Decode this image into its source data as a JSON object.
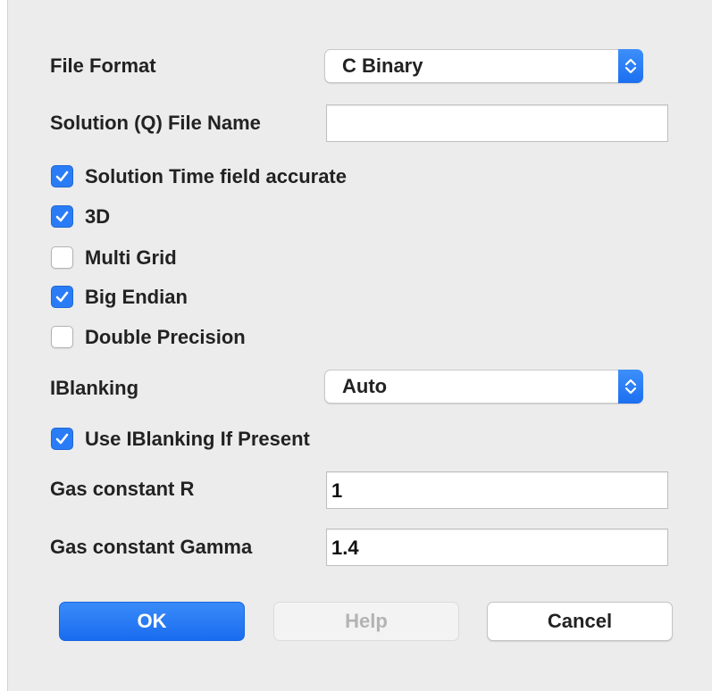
{
  "file_format": {
    "label": "File Format",
    "selected": "C Binary",
    "stepper_icon": "chevron-up-down-icon"
  },
  "solution_file": {
    "label": "Solution (Q) File Name",
    "value": ""
  },
  "checkboxes": [
    {
      "label": "Solution Time field accurate",
      "checked": true
    },
    {
      "label": "3D",
      "checked": true
    },
    {
      "label": "Multi Grid",
      "checked": false
    },
    {
      "label": "Big Endian",
      "checked": true
    },
    {
      "label": "Double Precision",
      "checked": false
    }
  ],
  "iblanking": {
    "label": "IBlanking",
    "selected": "Auto"
  },
  "use_iblanking": {
    "label": "Use IBlanking If Present",
    "checked": true
  },
  "gas_constant_r": {
    "label": "Gas constant R",
    "value": "1"
  },
  "gas_constant_gamma": {
    "label": "Gas constant Gamma",
    "value": "1.4"
  },
  "buttons": {
    "ok": "OK",
    "help": "Help",
    "cancel": "Cancel"
  },
  "colors": {
    "accent": "#2a7cf6",
    "dialog_bg": "#ececec"
  }
}
